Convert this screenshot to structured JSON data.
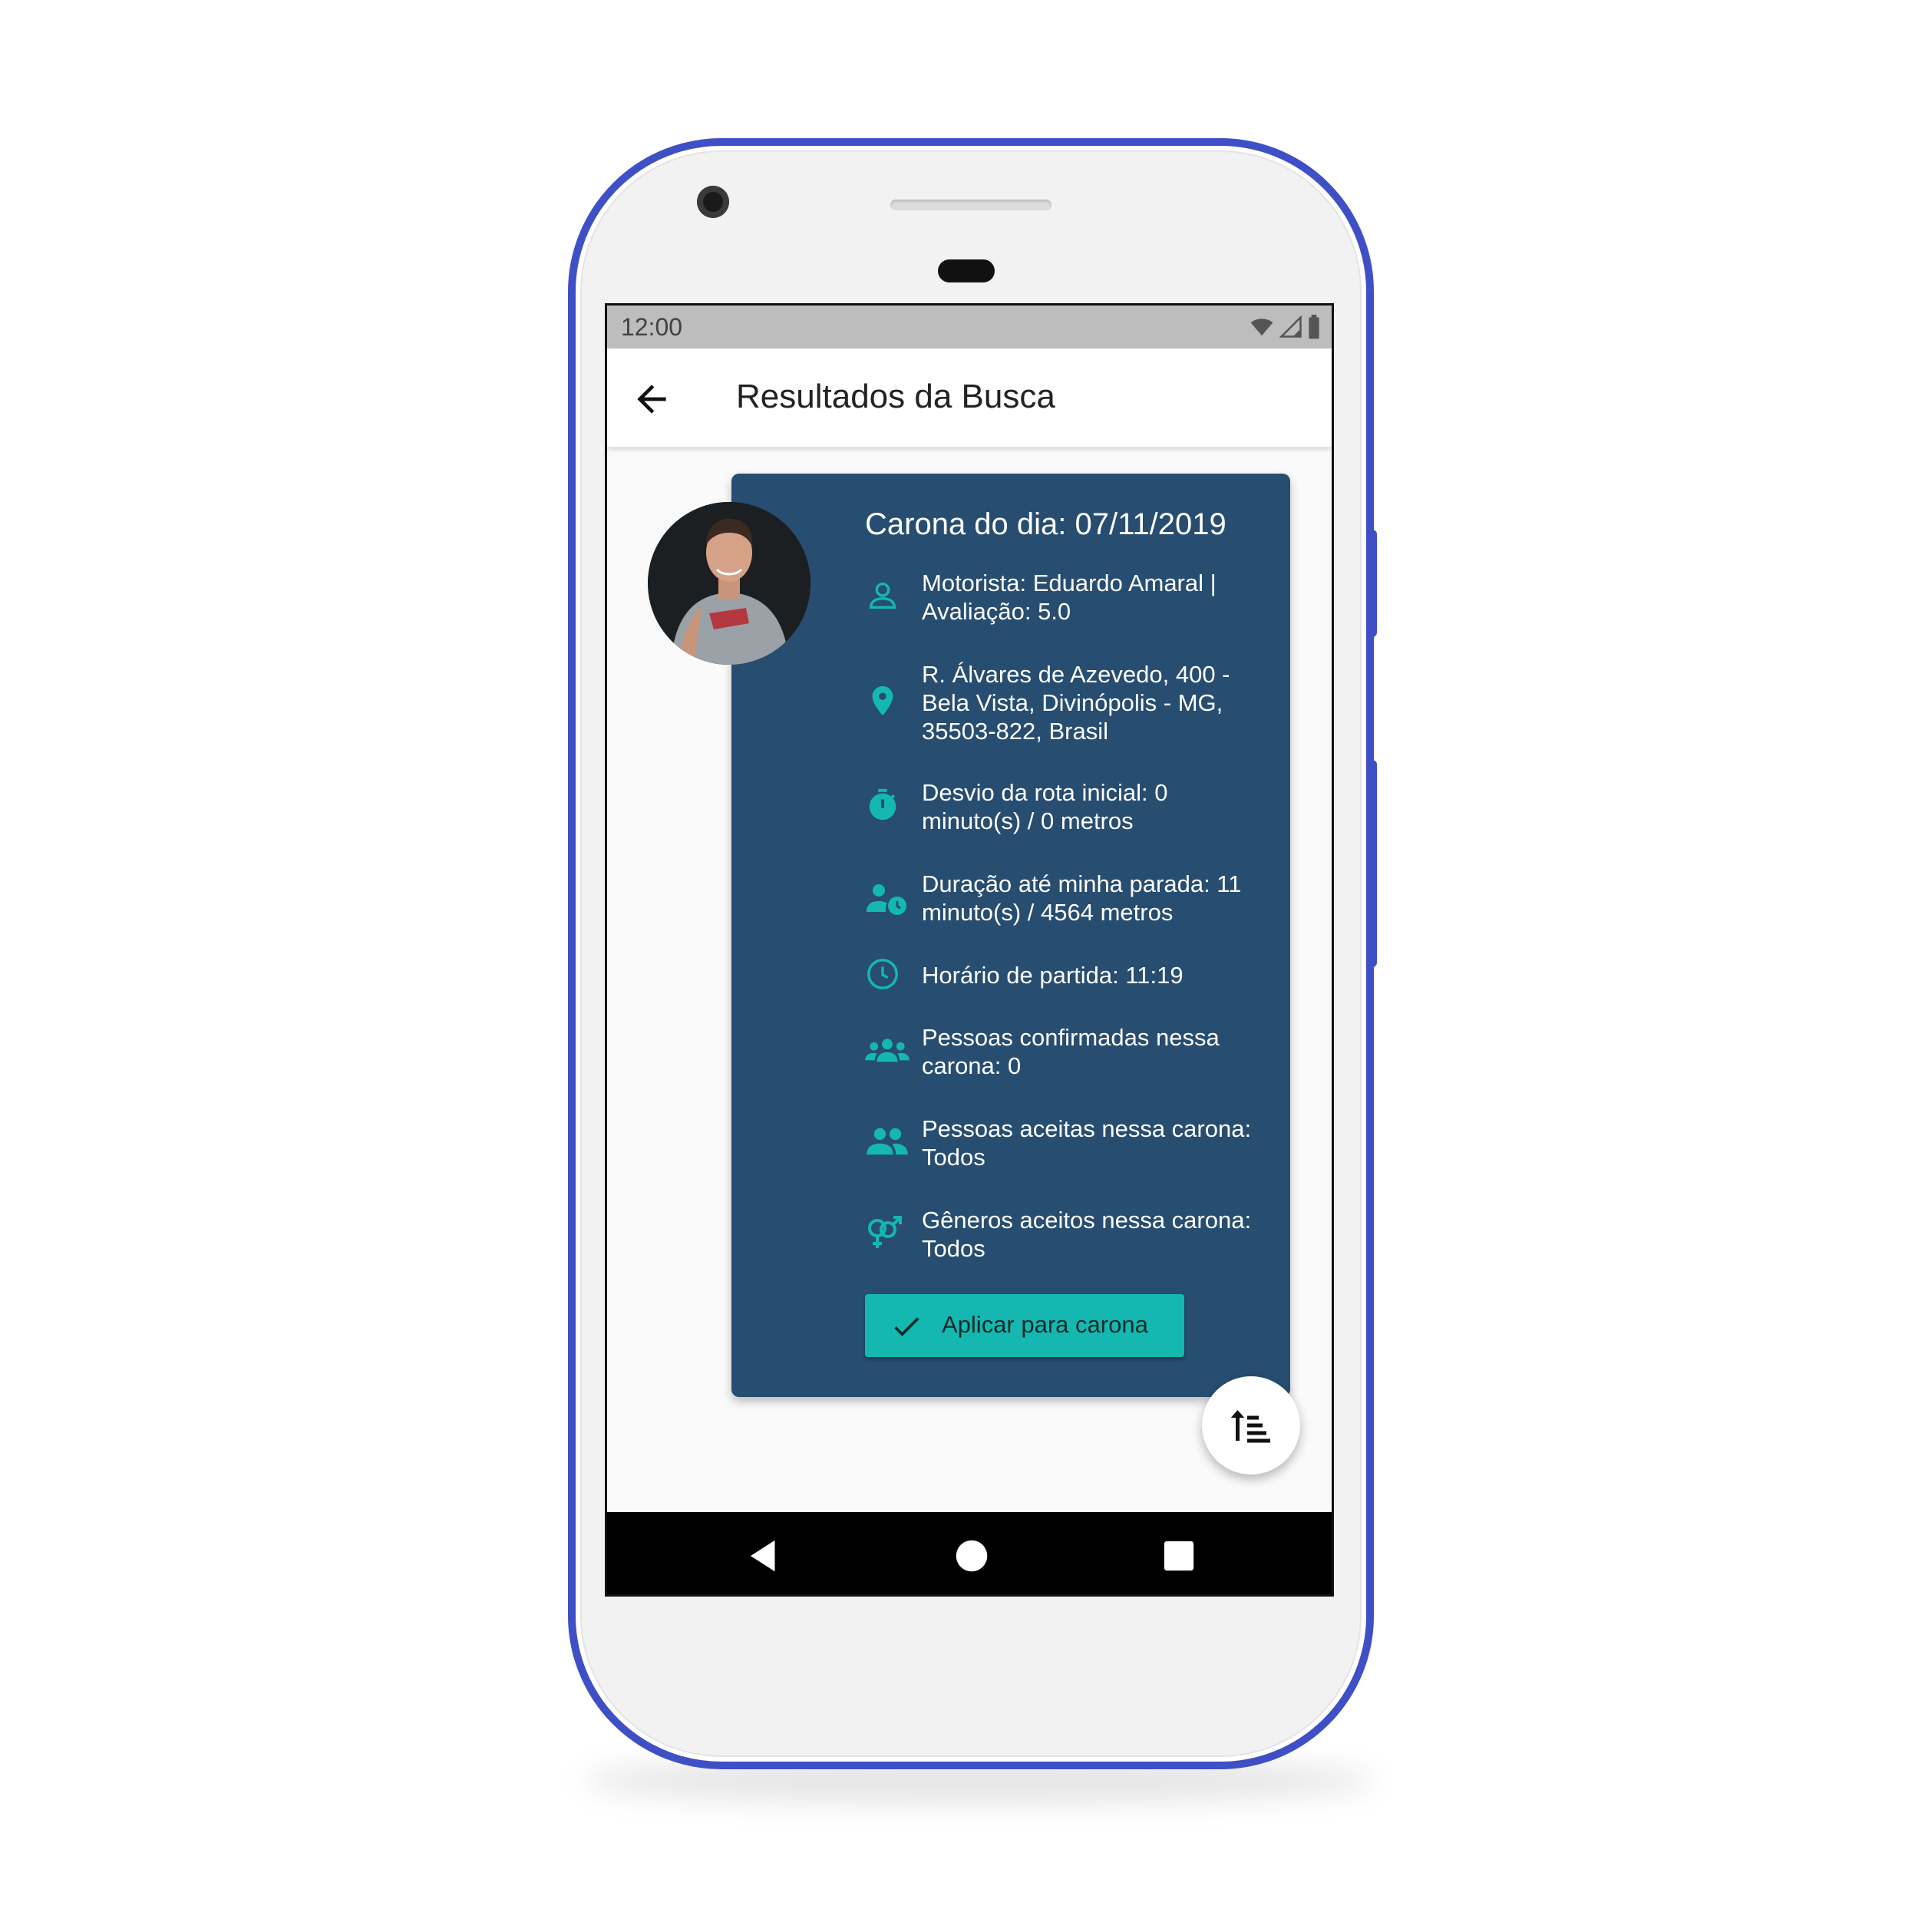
{
  "status_bar": {
    "time": "12:00"
  },
  "app_bar": {
    "title": "Resultados da Busca"
  },
  "card": {
    "title": "Carona do dia: 07/11/2019",
    "rows": [
      {
        "icon": "person-outline-icon",
        "text": "Motorista: Eduardo Amaral |\nAvaliação: 5.0"
      },
      {
        "icon": "location-pin-icon",
        "text": "R. Álvares de Azevedo, 400 -\nBela Vista, Divinópolis - MG,\n35503-822, Brasil"
      },
      {
        "icon": "timer-icon",
        "text": "Desvio da rota inicial: 0\nminuto(s) / 0 metros"
      },
      {
        "icon": "person-clock-icon",
        "text": "Duração até minha parada: 11\nminuto(s) / 4564 metros"
      },
      {
        "icon": "clock-icon",
        "text": "Horário de partida: 11:19"
      },
      {
        "icon": "group-icon",
        "text": "Pessoas confirmadas nessa\ncarona: 0"
      },
      {
        "icon": "people-icon",
        "text": "Pessoas aceitas nessa carona:\nTodos"
      },
      {
        "icon": "gender-icon",
        "text": "Gêneros aceitos nessa carona:\nTodos"
      }
    ],
    "apply_button_label": "Aplicar para carona"
  },
  "colors": {
    "card_background": "#274d70",
    "accent": "#14b8b0",
    "phone_frame": "#3f4fc6"
  }
}
